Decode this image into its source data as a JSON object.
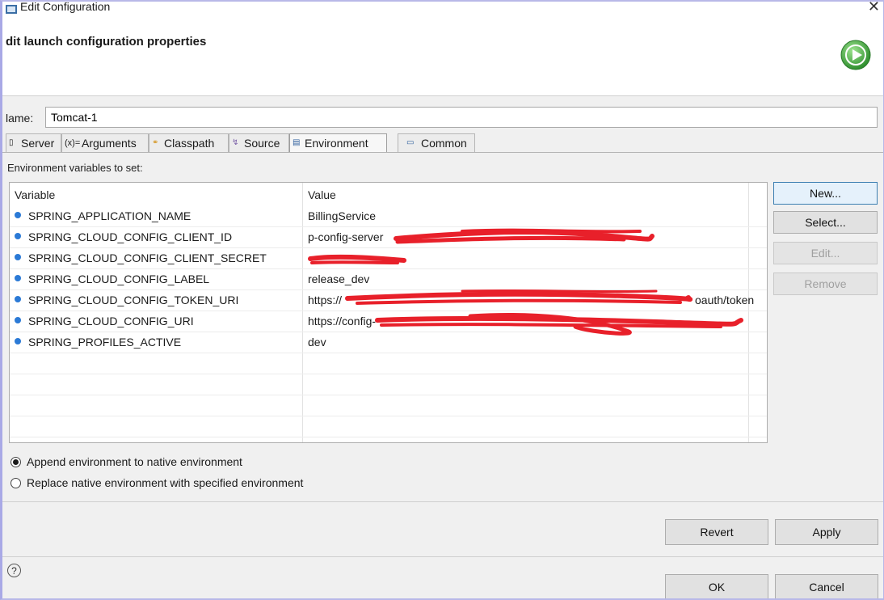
{
  "window": {
    "title": "Edit Configuration",
    "header": "dit launch configuration properties"
  },
  "name_field": {
    "label": "Name:",
    "label_visible": "lame:",
    "value": "Tomcat-1"
  },
  "tabs": [
    {
      "label": "Server",
      "icon": "server-icon"
    },
    {
      "label": "Arguments",
      "icon": "arguments-icon"
    },
    {
      "label": "Classpath",
      "icon": "classpath-icon"
    },
    {
      "label": "Source",
      "icon": "source-icon"
    },
    {
      "label": "Environment",
      "icon": "environment-icon",
      "active": true
    },
    {
      "label": "Common",
      "icon": "common-icon"
    }
  ],
  "env_section": {
    "label": "Environment variables to set:",
    "columns": [
      "Variable",
      "Value"
    ],
    "rows": [
      {
        "variable": "SPRING_APPLICATION_NAME",
        "value": "BillingService"
      },
      {
        "variable": "SPRING_CLOUD_CONFIG_CLIENT_ID",
        "value": "p-config-server"
      },
      {
        "variable": "SPRING_CLOUD_CONFIG_CLIENT_SECRET",
        "value": ""
      },
      {
        "variable": "SPRING_CLOUD_CONFIG_LABEL",
        "value": "release_dev"
      },
      {
        "variable": "SPRING_CLOUD_CONFIG_TOKEN_URI",
        "value": "https://"
      },
      {
        "variable": "SPRING_CLOUD_CONFIG_URI",
        "value": "https://config-"
      },
      {
        "variable": "SPRING_PROFILES_ACTIVE",
        "value": "dev"
      }
    ],
    "token_uri_suffix": "oauth/token"
  },
  "side_buttons": {
    "new": "New...",
    "select": "Select...",
    "edit": "Edit...",
    "remove": "Remove"
  },
  "radios": {
    "append": "Append environment to native environment",
    "replace": "Replace native environment with specified environment",
    "selected": "append"
  },
  "footer": {
    "revert": "Revert",
    "apply": "Apply",
    "ok": "OK",
    "cancel": "Cancel",
    "help": "?"
  },
  "colors": {
    "redaction": "#e8202a",
    "run_icon": "#3fae3c",
    "accent": "#3c7fb1"
  }
}
